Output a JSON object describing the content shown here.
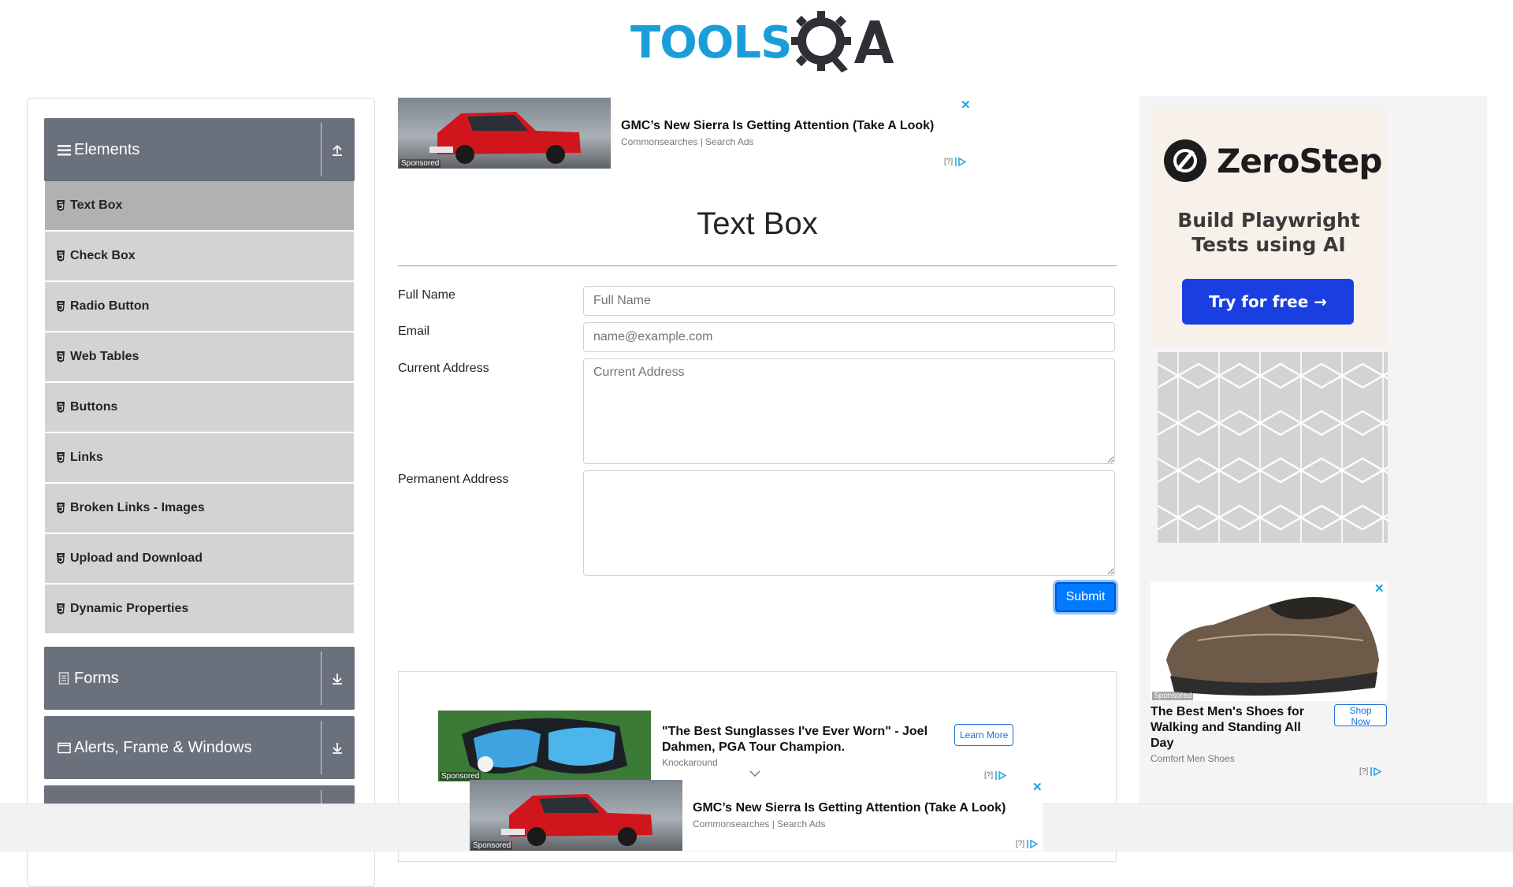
{
  "header": {
    "logo_primary": "TOOLS",
    "logo_secondary": "QA"
  },
  "sidebar": {
    "group_elements": "Elements",
    "items": [
      {
        "label": "Text Box"
      },
      {
        "label": "Check Box"
      },
      {
        "label": "Radio Button"
      },
      {
        "label": "Web Tables"
      },
      {
        "label": "Buttons"
      },
      {
        "label": "Links"
      },
      {
        "label": "Broken Links - Images"
      },
      {
        "label": "Upload and Download"
      },
      {
        "label": "Dynamic Properties"
      }
    ],
    "group_forms": "Forms",
    "group_alerts": "Alerts, Frame & Windows"
  },
  "ad_top": {
    "title": "GMC’s New Sierra Is Getting Attention (Take A Look)",
    "source": "Commonsearches | Search Ads",
    "sponsored": "Sponsored",
    "info": "[?]",
    "close": "✕"
  },
  "page": {
    "title": "Text Box"
  },
  "form": {
    "full_name_label": "Full Name",
    "full_name_placeholder": "Full Name",
    "email_label": "Email",
    "email_placeholder": "name@example.com",
    "current_address_label": "Current Address",
    "current_address_placeholder": "Current Address",
    "permanent_address_label": "Permanent Address",
    "submit_label": "Submit"
  },
  "ad_bottom": {
    "title": "\"The Best Sunglasses I've Ever Worn\" - Joel Dahmen, PGA Tour Champion.",
    "source": "Knockaround",
    "button": "Learn More",
    "sponsored": "Sponsored",
    "info": "[?]"
  },
  "ad_zerostep": {
    "brand": "ZeroStep",
    "tagline_1": "Build Playwright",
    "tagline_2": "Tests using AI",
    "cta": "Try for free →"
  },
  "ad_shoes": {
    "title": "The Best Men's Shoes for Walking and Standing All Day",
    "source": "Comfort Men Shoes",
    "button": "Shop Now",
    "sponsored": "Sponsored",
    "info": "[?]",
    "close": "✕"
  },
  "ad_sticky": {
    "title": "GMC’s New Sierra Is Getting Attention (Take A Look)",
    "source": "Commonsearches | Search Ads",
    "sponsored": "Sponsored",
    "info": "[?]",
    "close": "✕"
  },
  "colors": {
    "sidebar_header": "#6a717c",
    "menu_item": "#d3d3d3",
    "menu_active": "#b1b1b1",
    "primary": "#007bff",
    "logo_blue": "#1b9ed8"
  }
}
